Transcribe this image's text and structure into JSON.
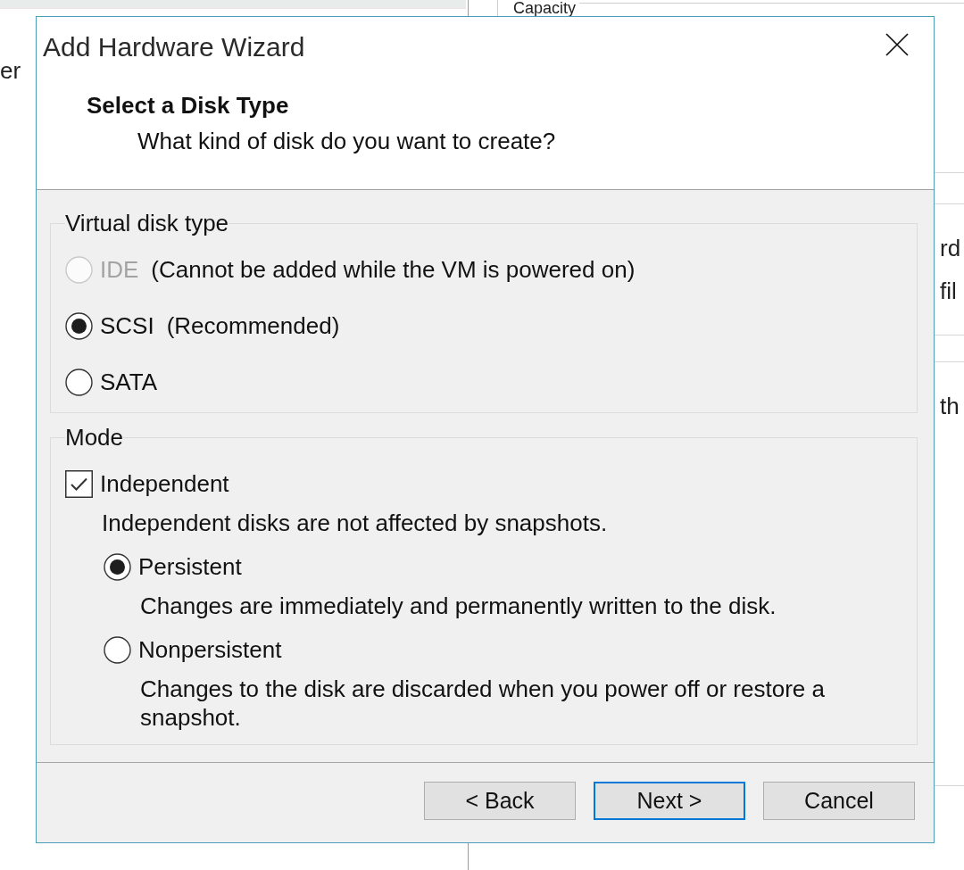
{
  "background_window": {
    "left_pane": {
      "text": "er"
    },
    "right_pane": {
      "group_label": "Capacity",
      "texts": [
        "rd",
        "fil",
        "th"
      ]
    }
  },
  "dialog": {
    "title": "Add Hardware Wizard",
    "header": {
      "title": "Select a Disk Type",
      "subtitle": "What kind of disk do you want to create?"
    },
    "groups": [
      {
        "label": "Virtual disk type",
        "items": [
          {
            "kind": "radio",
            "label": "IDE",
            "note": "(Cannot be added while the VM is powered on)",
            "selected": false,
            "disabled": true
          },
          {
            "kind": "radio",
            "label": "SCSI",
            "note": "(Recommended)",
            "selected": true,
            "disabled": false
          },
          {
            "kind": "radio",
            "label": "SATA",
            "selected": false,
            "disabled": false
          }
        ]
      },
      {
        "label": "Mode",
        "items": [
          {
            "kind": "checkbox",
            "label": "Independent",
            "checked": true,
            "description": "Independent disks are not affected by snapshots.",
            "children": [
              {
                "kind": "radio",
                "label": "Persistent",
                "selected": true,
                "description": "Changes are immediately and permanently written to the disk."
              },
              {
                "kind": "radio",
                "label": "Nonpersistent",
                "selected": false,
                "description": "Changes to the disk are discarded when you power off or restore a snapshot."
              }
            ]
          }
        ]
      }
    ],
    "buttons": [
      {
        "label": "< Back",
        "default": false
      },
      {
        "label": "Next >",
        "default": true
      },
      {
        "label": "Cancel",
        "default": false
      }
    ]
  }
}
